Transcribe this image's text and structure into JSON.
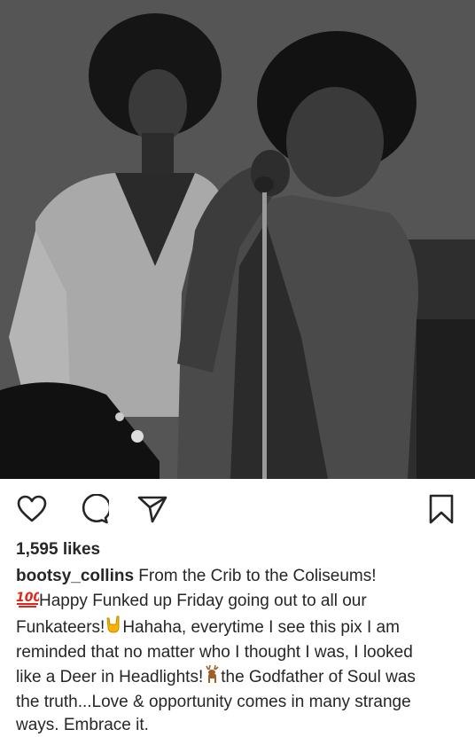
{
  "post": {
    "username": "bootsy_collins",
    "likes": "1,595 likes",
    "caption_lines": [
      " From the Crib to the Coliseums!",
      "Happy Funked up Friday going out to all our",
      "Funkateers!",
      "Hahaha, everytime I see this pix I am",
      "reminded that no matter who I thought I was, I looked",
      "like a Deer in Headlights!",
      "the Godfather of Soul was",
      "the truth...Love & opportunity comes in many strange",
      "ways. Embrace it."
    ]
  },
  "icons": {
    "like": "heart-icon",
    "comment": "comment-icon",
    "share": "paper-plane-icon",
    "save": "bookmark-icon",
    "emoji_100": "hundred-points-emoji",
    "emoji_rock": "sign-of-horns-emoji",
    "emoji_deer": "deer-emoji"
  },
  "colors": {
    "text": "#262626",
    "background": "#ffffff",
    "emoji_red": "#e0261b",
    "emoji_yellow": "#f4b400",
    "emoji_brown": "#a0602a"
  }
}
